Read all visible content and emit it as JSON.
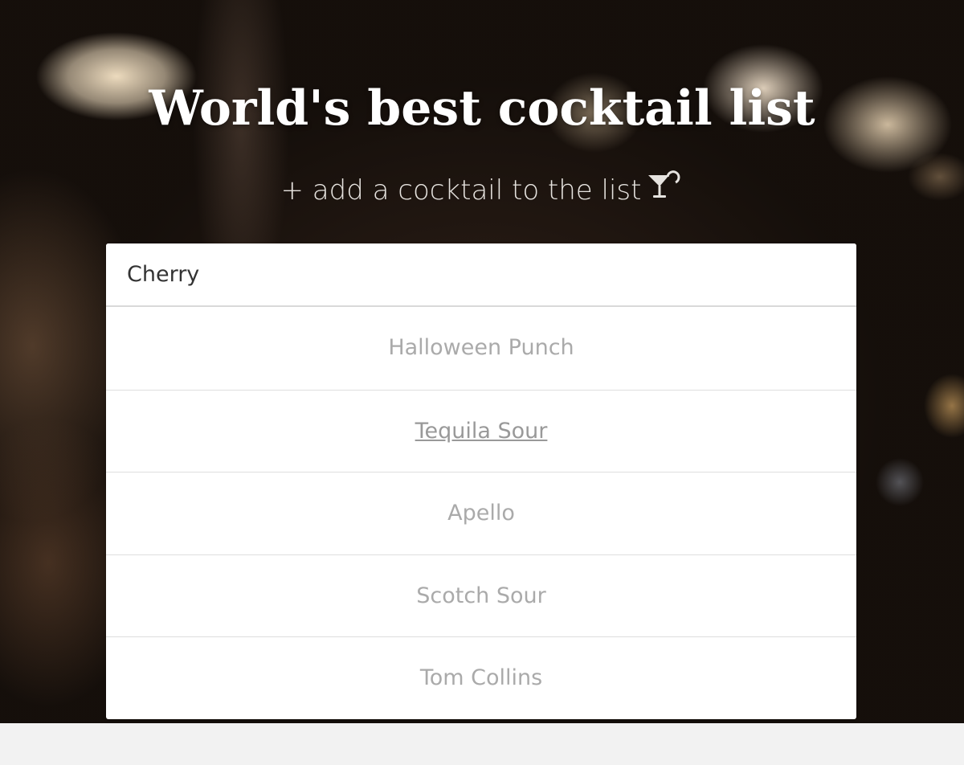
{
  "header": {
    "title": "World's best cocktail list",
    "add_label": "+ add a cocktail to the list",
    "add_icon": "cocktail-glass-icon"
  },
  "search": {
    "value": "Cherry"
  },
  "results": [
    {
      "name": "Halloween Punch",
      "hovered": false
    },
    {
      "name": "Tequila Sour",
      "hovered": true
    },
    {
      "name": "Apello",
      "hovered": false
    },
    {
      "name": "Scotch Sour",
      "hovered": false
    },
    {
      "name": "Tom Collins",
      "hovered": false
    }
  ],
  "colors": {
    "title": "#ffffff",
    "result_text": "#aaaaaa",
    "footer_bg": "#f2f2f2"
  }
}
